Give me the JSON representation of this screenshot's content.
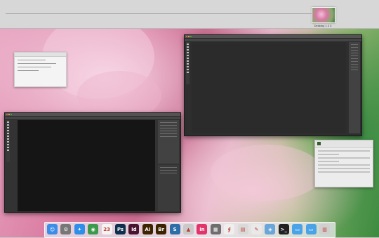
{
  "spaces": {
    "desktop_label": "Desktop 1 2 3"
  },
  "dock": {
    "items": [
      {
        "name": "finder-icon",
        "glyph": "☺",
        "color": "#3b8de8"
      },
      {
        "name": "system-preferences-icon",
        "glyph": "⚙",
        "color": "#777777"
      },
      {
        "name": "safari-icon",
        "glyph": "✦",
        "color": "#2f8fe8"
      },
      {
        "name": "chrome-icon",
        "glyph": "◉",
        "color": "#3c9a4c"
      },
      {
        "name": "calendar-icon",
        "glyph": "23",
        "color": "#f4f4f4"
      },
      {
        "name": "photoshop-icon",
        "glyph": "Ps",
        "color": "#0f2f4f"
      },
      {
        "name": "indesign-icon",
        "glyph": "Id",
        "color": "#4a1431"
      },
      {
        "name": "illustrator-icon",
        "glyph": "Ai",
        "color": "#3d2300"
      },
      {
        "name": "bridge-icon",
        "glyph": "Br",
        "color": "#3b2300"
      },
      {
        "name": "sublime-icon",
        "glyph": "S",
        "color": "#2d6ea8"
      },
      {
        "name": "rocket-icon",
        "glyph": "▲",
        "color": "#c9c9c9"
      },
      {
        "name": "invision-icon",
        "glyph": "in",
        "color": "#e2336b"
      },
      {
        "name": "mission-control-icon",
        "glyph": "▦",
        "color": "#6e6e6e"
      },
      {
        "name": "acrobat-icon",
        "glyph": "⨚",
        "color": "#efefef"
      },
      {
        "name": "archive-utility-icon",
        "glyph": "▤",
        "color": "#d9d9d9"
      },
      {
        "name": "textedit-icon",
        "glyph": "✎",
        "color": "#e9e9e9"
      },
      {
        "name": "preview-icon",
        "glyph": "◈",
        "color": "#6aa6d8"
      },
      {
        "name": "terminal-icon",
        "glyph": ">_",
        "color": "#222222"
      },
      {
        "name": "applications-folder-icon",
        "glyph": "▭",
        "color": "#4aa3e6"
      },
      {
        "name": "documents-folder-icon",
        "glyph": "▭",
        "color": "#4aa3e6"
      },
      {
        "name": "trash-icon",
        "glyph": "▥",
        "color": "#cfcfcf"
      }
    ]
  }
}
